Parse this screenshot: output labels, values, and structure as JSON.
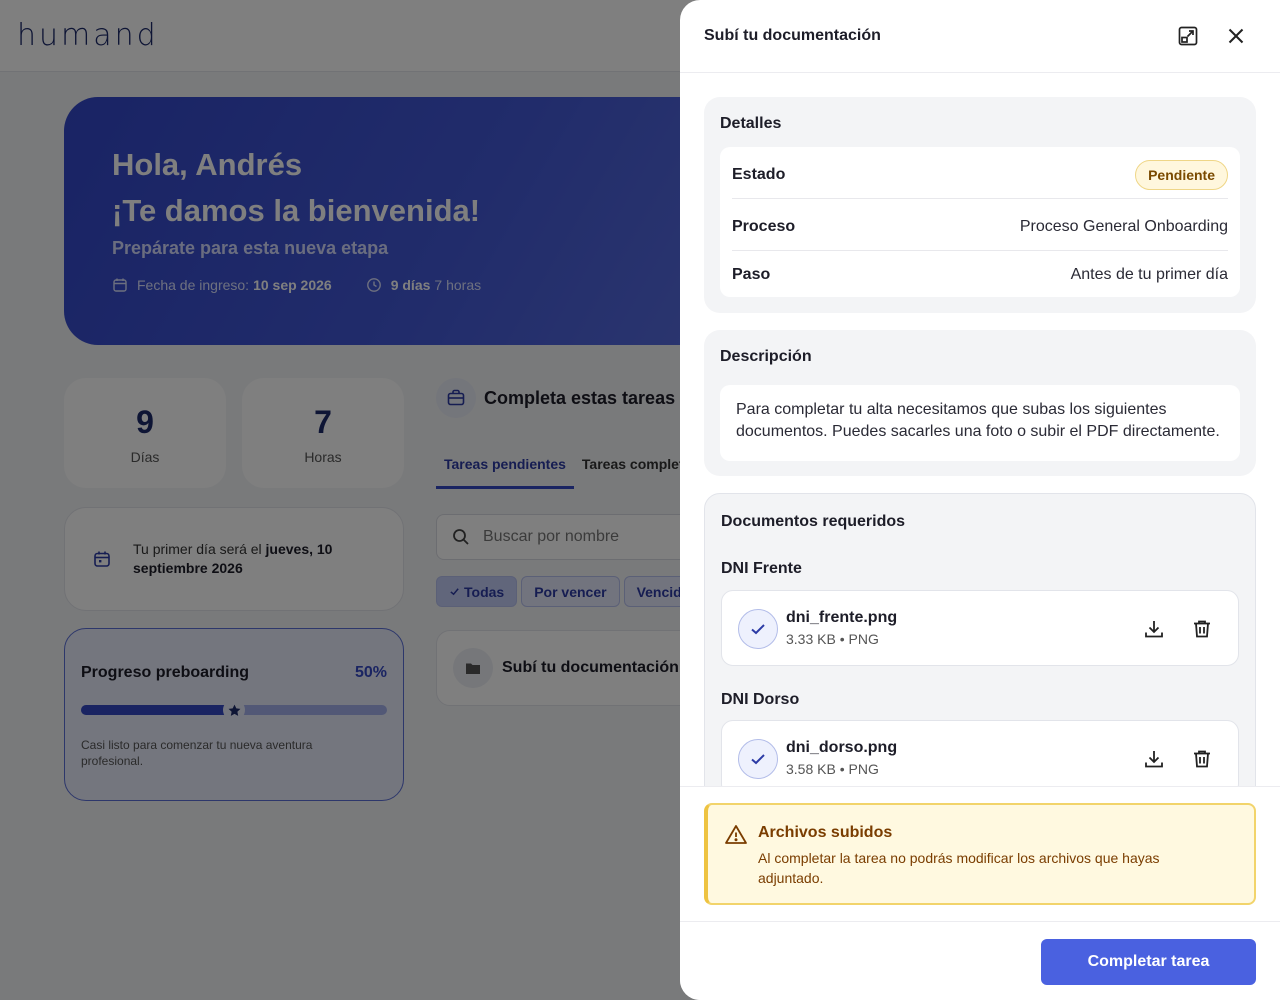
{
  "brand": {
    "logo_text": "humand"
  },
  "hero": {
    "greeting": "Hola, Andrés",
    "welcome": "¡Te damos la bienvenida!",
    "subtitle": "Prepárate para esta nueva etapa",
    "start_label": "Fecha de ingreso:",
    "start_date": "10 sep 2026",
    "countdown_days": "9 días",
    "countdown_hours": "7 horas"
  },
  "counters": [
    {
      "value": "9",
      "label": "Días"
    },
    {
      "value": "7",
      "label": "Horas"
    }
  ],
  "first_day": {
    "prefix": "Tu primer día será el",
    "date": "jueves, 10 septiembre 2026"
  },
  "progress": {
    "title": "Progreso preboarding",
    "percent_label": "50%",
    "value": 0.5,
    "description": "Casi listo para comenzar tu nueva aventura profesional."
  },
  "tasks": {
    "heading": "Completa estas tareas a",
    "tabs": [
      {
        "label": "Tareas pendientes",
        "active": true
      },
      {
        "label": "Tareas complet",
        "active": false
      }
    ],
    "search_placeholder": "Buscar por nombre",
    "filters": [
      {
        "label": "Todas",
        "selected": true
      },
      {
        "label": "Por vencer",
        "selected": false
      },
      {
        "label": "Vencid",
        "selected": false
      }
    ],
    "items": [
      {
        "title": "Subí tu documentación"
      }
    ]
  },
  "drawer": {
    "title": "Subí tu documentación",
    "details": {
      "title": "Detalles",
      "rows": [
        {
          "key": "Estado",
          "value": "Pendiente",
          "type": "badge"
        },
        {
          "key": "Proceso",
          "value": "Proceso General Onboarding"
        },
        {
          "key": "Paso",
          "value": "Antes de tu primer día"
        }
      ]
    },
    "description": {
      "title": "Descripción",
      "text": "Para completar tu alta necesitamos que subas los siguientes documentos. Puedes sacarles una foto o subir el PDF directamente."
    },
    "documents": {
      "title": "Documentos requeridos",
      "items": [
        {
          "label": "DNI Frente",
          "file_name": "dni_frente.png",
          "file_meta": "3.33 KB • PNG"
        },
        {
          "label": "DNI Dorso",
          "file_name": "dni_dorso.png",
          "file_meta": "3.58 KB • PNG"
        }
      ]
    },
    "alert": {
      "title": "Archivos subidos",
      "text": "Al completar la tarea no podrás modificar los archivos que hayas adjuntado."
    },
    "complete_label": "Completar tarea"
  },
  "colors": {
    "primary": "#4a61e0",
    "brand_dark": "#1d2a6b",
    "warning_bg": "#fff9e0",
    "warning_text": "#7a3d00",
    "badge_bg": "#fff7dd"
  },
  "icons": {
    "calendar": "calendar-icon",
    "clock": "clock-icon",
    "briefcase": "briefcase-icon",
    "search": "search-icon",
    "check": "check-icon",
    "folder": "folder-icon",
    "expand": "expand-icon",
    "close": "close-icon",
    "download": "download-icon",
    "trash": "trash-icon",
    "warning": "warning-icon",
    "star": "star-icon"
  }
}
